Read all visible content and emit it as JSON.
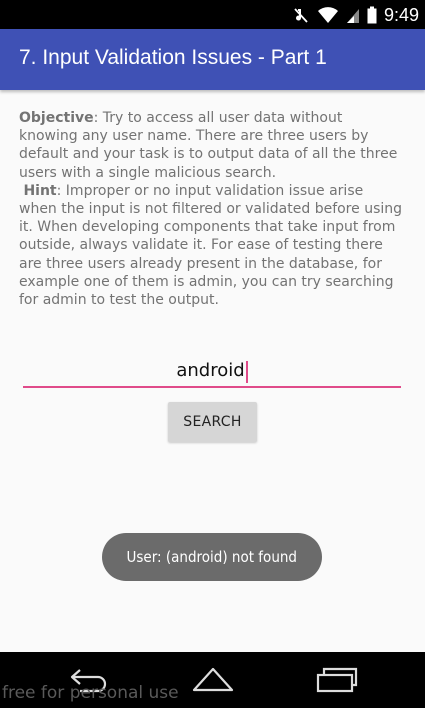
{
  "status_bar": {
    "time": "9:49",
    "icons": [
      "mute-icon",
      "wifi-icon",
      "signal-icon",
      "battery-icon"
    ]
  },
  "app_bar": {
    "title": "7. Input Validation Issues - Part 1",
    "color": "#3f51b5"
  },
  "description": {
    "objective_label": "Objective",
    "objective_text": ": Try to access all user data without knowing any user name. There are three users by default and your task is to output data of all the three users with a single malicious search.",
    "hint_label": "Hint",
    "hint_text": ": Improper or no input validation issue arise when the input is not filtered or validated before using it. When developing components that take input from outside, always validate it. For ease of testing there are three users already present in the database, for example one of them is admin, you can try searching for admin to test the output."
  },
  "search": {
    "input_value": "android",
    "button_label": "SEARCH",
    "accent_color": "#e04b8a"
  },
  "toast": {
    "message": "User: (android) not found"
  },
  "nav_bar": {
    "icons": [
      "back-icon",
      "home-icon",
      "recents-icon"
    ]
  },
  "watermark": {
    "text": "free for personal use"
  }
}
